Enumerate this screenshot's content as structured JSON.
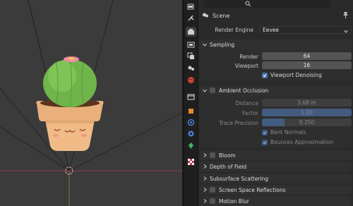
{
  "properties": {
    "scene_label": "Scene",
    "render_engine": {
      "label": "Render Engine",
      "value": "Eevee"
    },
    "sampling": {
      "title": "Sampling",
      "render": {
        "label": "Render",
        "value": "64"
      },
      "viewport": {
        "label": "Viewport",
        "value": "16"
      },
      "viewport_denoising": {
        "label": "Viewport Denoising",
        "checked": true
      }
    },
    "ambient_occlusion": {
      "title": "Ambient Occlusion",
      "distance": {
        "label": "Distance",
        "value": "3.68 m"
      },
      "factor": {
        "label": "Factor",
        "value": "1.00",
        "fraction": 1.0
      },
      "trace_precision": {
        "label": "Trace Precision",
        "value": "0.250",
        "fraction": 0.25
      },
      "bent_normals": {
        "label": "Bent Normals",
        "checked": true
      },
      "bounces_approx": {
        "label": "Bounces Approximation",
        "checked": true
      }
    },
    "collapsed_panels": [
      "Bloom",
      "Depth of Field",
      "Subsurface Scattering",
      "Screen Space Reflections",
      "Motion Blur"
    ],
    "tab_icons": [
      "tool-icon",
      "render-icon",
      "output-icon",
      "view-layer-icon",
      "scene-icon",
      "world-icon",
      "collection-icon",
      "object-icon",
      "modifier-icon",
      "particles-icon",
      "physics-icon",
      "constraints-icon",
      "data-icon",
      "material-icon",
      "texture-icon"
    ]
  },
  "colors": {
    "accent": "#4772b3",
    "panel": "#303030",
    "header": "#1f1f1f"
  }
}
